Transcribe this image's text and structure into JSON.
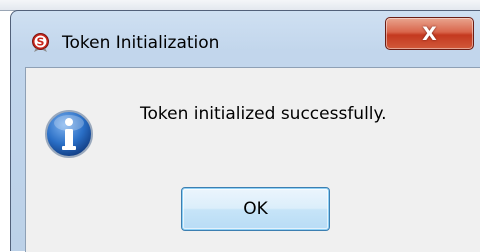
{
  "dialog": {
    "title": "Token Initialization",
    "app_icon": "app-logo-icon",
    "close_label": "X",
    "message_icon": "info-icon",
    "message": "Token initialized successfully.",
    "ok_label": "OK"
  },
  "colors": {
    "frame": "#c2d6ec",
    "client_background": "#f0f0f0",
    "close_button": "#c4391f",
    "ok_button_border": "#3c7fb1",
    "info_icon": "#1f5fb5"
  }
}
